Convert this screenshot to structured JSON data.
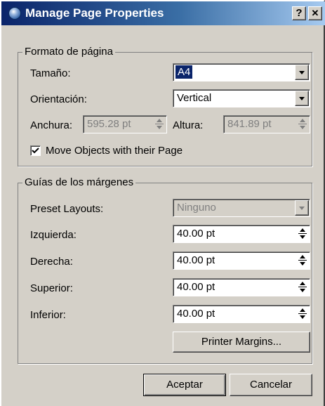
{
  "window": {
    "title": "Manage Page Properties",
    "help_label": "?",
    "close_label": "✕"
  },
  "page_format": {
    "legend": "Formato de página",
    "size_label": "Tamaño:",
    "size_value": "A4",
    "orientation_label": "Orientación:",
    "orientation_value": "Vertical",
    "width_label": "Anchura:",
    "width_value": "595.28 pt",
    "height_label": "Altura:",
    "height_value": "841.89 pt",
    "move_objects_label": "Move Objects with their Page",
    "move_objects_checked": true
  },
  "margin_guides": {
    "legend": "Guías de los márgenes",
    "preset_label": "Preset Layouts:",
    "preset_value": "Ninguno",
    "left_label": "Izquierda:",
    "left_value": "40.00 pt",
    "right_label": "Derecha:",
    "right_value": "40.00 pt",
    "top_label": "Superior:",
    "top_value": "40.00 pt",
    "bottom_label": "Inferior:",
    "bottom_value": "40.00 pt",
    "printer_margins_label": "Printer Margins..."
  },
  "buttons": {
    "accept_label": "Aceptar",
    "cancel_label": "Cancelar"
  }
}
